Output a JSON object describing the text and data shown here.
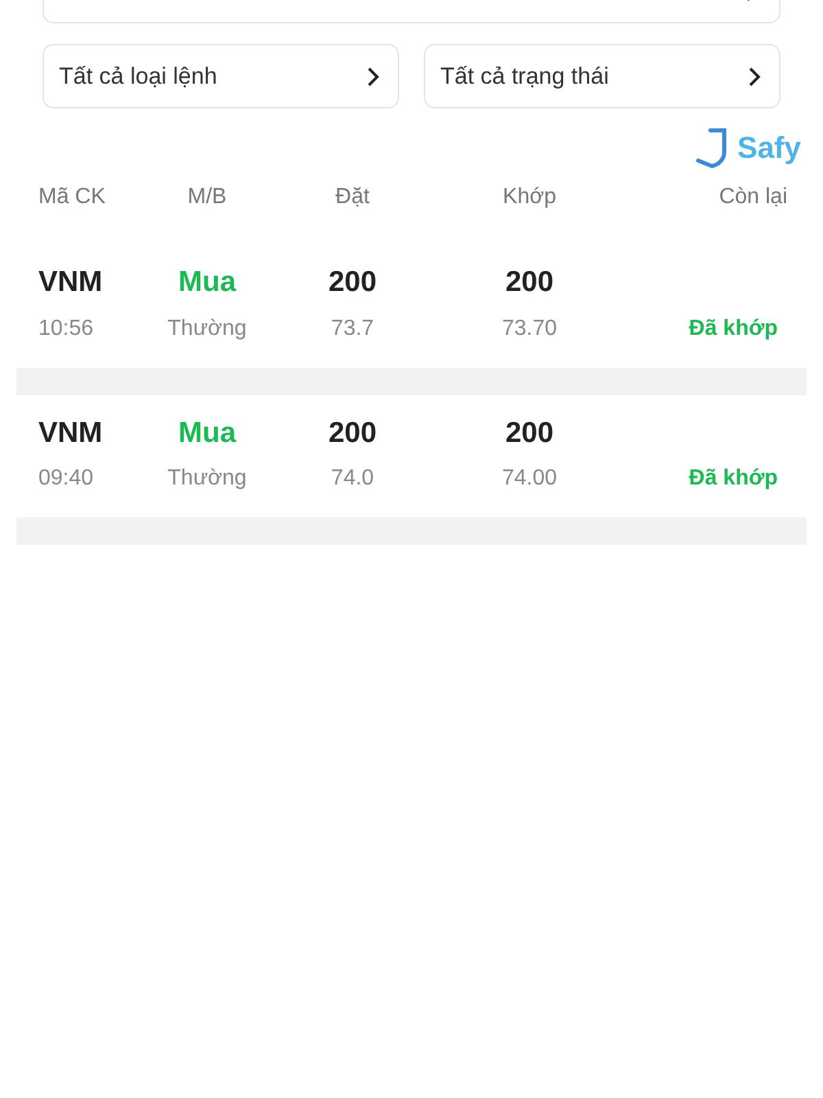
{
  "filters": [
    {
      "label": "Tất cả loại lệnh"
    },
    {
      "label": "Tất cả trạng thái"
    }
  ],
  "brand": {
    "name": "Safy"
  },
  "columns": [
    "Mã CK",
    "M/B",
    "Đặt",
    "Khớp",
    "Còn lại"
  ],
  "orders": [
    {
      "symbol": "VNM",
      "time": "10:56",
      "side": {
        "text": "Mua",
        "color": "#1db954"
      },
      "type": "Thường",
      "order_qty": "200",
      "order_price": "73.7",
      "match_qty": "200",
      "match_price": "73.70",
      "status": {
        "text": "Đã khớp",
        "color": "#1db954"
      }
    },
    {
      "symbol": "VNM",
      "time": "09:40",
      "side": {
        "text": "Mua",
        "color": "#1db954"
      },
      "type": "Thường",
      "order_qty": "200",
      "order_price": "74.0",
      "match_qty": "200",
      "match_price": "74.00",
      "status": {
        "text": "Đã khớp",
        "color": "#1db954"
      }
    }
  ]
}
